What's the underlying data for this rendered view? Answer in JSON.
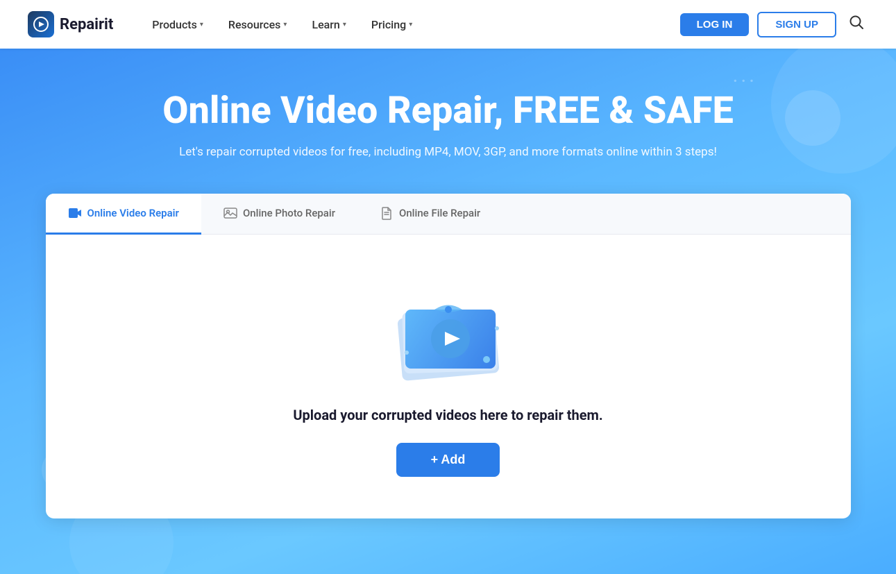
{
  "navbar": {
    "logo_text": "Repairit",
    "nav_items": [
      {
        "label": "Products",
        "has_dropdown": true
      },
      {
        "label": "Resources",
        "has_dropdown": true
      },
      {
        "label": "Learn",
        "has_dropdown": true
      },
      {
        "label": "Pricing",
        "has_dropdown": true
      }
    ],
    "btn_login": "LOG IN",
    "btn_signup": "SIGN UP"
  },
  "hero": {
    "title": "Online Video Repair, FREE & SAFE",
    "subtitle": "Let's repair corrupted videos for free, including MP4, MOV, 3GP, and more formats online within 3 steps!"
  },
  "tabs": [
    {
      "label": "Online Video Repair",
      "icon_type": "video",
      "active": true
    },
    {
      "label": "Online Photo Repair",
      "icon_type": "photo",
      "active": false
    },
    {
      "label": "Online File Repair",
      "icon_type": "file",
      "active": false
    }
  ],
  "card": {
    "upload_text": "Upload your corrupted videos here to repair them.",
    "add_button_label": "+ Add"
  }
}
